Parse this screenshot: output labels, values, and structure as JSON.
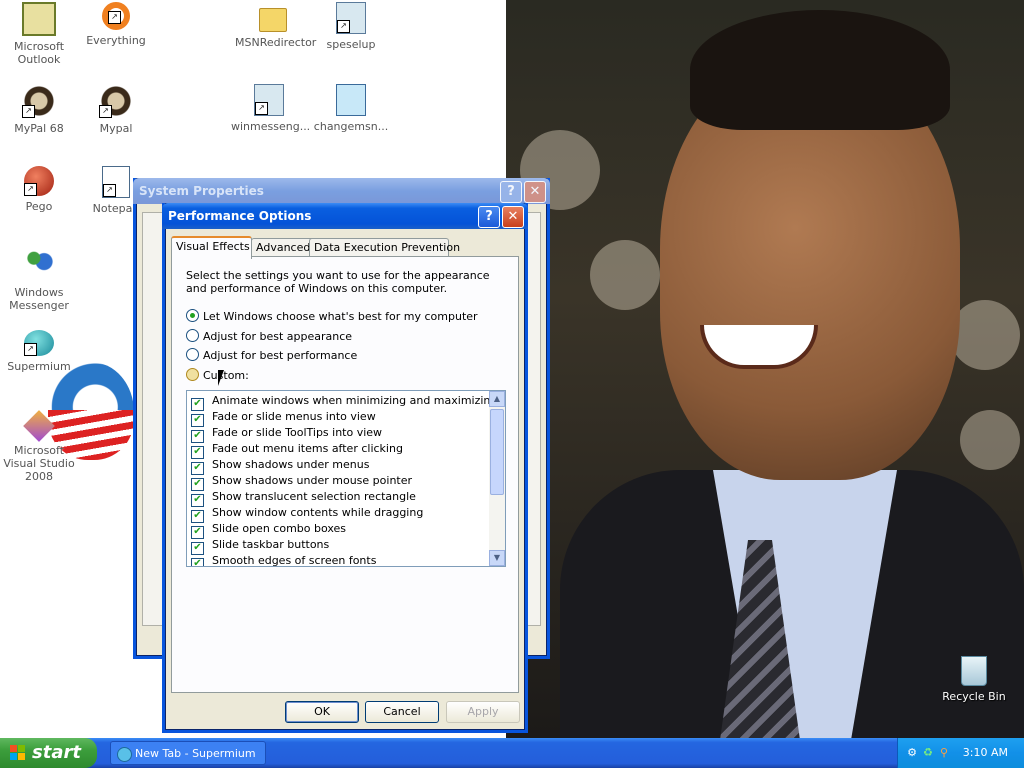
{
  "desktop": {
    "icons": [
      {
        "label": "Microsoft Outlook"
      },
      {
        "label": "Everything"
      },
      {
        "label": "MSNRedirector"
      },
      {
        "label": "speselup"
      },
      {
        "label": "MyPal 68"
      },
      {
        "label": "Mypal"
      },
      {
        "label": "winmesseng..."
      },
      {
        "label": "changemsn..."
      },
      {
        "label": "Pego"
      },
      {
        "label": "Notepad"
      },
      {
        "label": "Windows Messenger"
      },
      {
        "label": "Supermium"
      },
      {
        "label": "Microsoft Visual Studio 2008"
      },
      {
        "label": "Recycle Bin"
      }
    ]
  },
  "system_properties": {
    "title": "System Properties",
    "help_glyph": "?",
    "close_glyph": "✕"
  },
  "performance_options": {
    "title": "Performance Options",
    "help_glyph": "?",
    "close_glyph": "✕",
    "tabs": [
      {
        "label": "Visual Effects",
        "active": true
      },
      {
        "label": "Advanced",
        "active": false
      },
      {
        "label": "Data Execution Prevention",
        "active": false
      }
    ],
    "description": "Select the settings you want to use for the appearance and performance of Windows on this computer.",
    "radios": [
      {
        "label": "Let Windows choose what's best for my computer",
        "selected": true
      },
      {
        "label": "Adjust for best appearance",
        "selected": false
      },
      {
        "label": "Adjust for best performance",
        "selected": false
      },
      {
        "label": "Custom:",
        "selected": false
      }
    ],
    "effects": [
      {
        "label": "Animate windows when minimizing and maximizing",
        "checked": true
      },
      {
        "label": "Fade or slide menus into view",
        "checked": true
      },
      {
        "label": "Fade or slide ToolTips into view",
        "checked": true
      },
      {
        "label": "Fade out menu items after clicking",
        "checked": true
      },
      {
        "label": "Show shadows under menus",
        "checked": true
      },
      {
        "label": "Show shadows under mouse pointer",
        "checked": true
      },
      {
        "label": "Show translucent selection rectangle",
        "checked": true
      },
      {
        "label": "Show window contents while dragging",
        "checked": true
      },
      {
        "label": "Slide open combo boxes",
        "checked": true
      },
      {
        "label": "Slide taskbar buttons",
        "checked": true
      },
      {
        "label": "Smooth edges of screen fonts",
        "checked": true
      }
    ],
    "check_glyph": "✔",
    "scroll_up_glyph": "▲",
    "scroll_down_glyph": "▼",
    "buttons": {
      "ok": "OK",
      "cancel": "Cancel",
      "apply": "Apply"
    }
  },
  "taskbar": {
    "start_label": "start",
    "task_button": "New Tab - Supermium",
    "clock": "3:10 AM"
  },
  "colors": {
    "xp_blue": "#0453d8",
    "start_green": "#3c9e3c",
    "check_green": "#21a121"
  }
}
